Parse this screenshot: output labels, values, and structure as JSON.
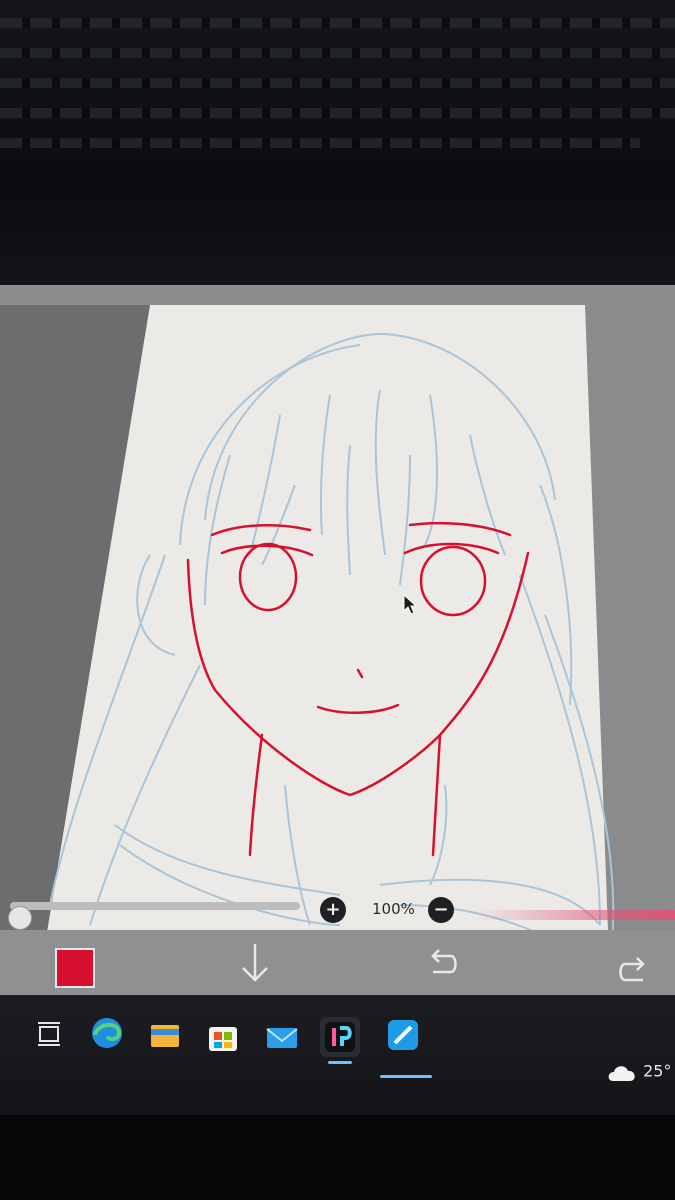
{
  "app": {
    "name": "ibisPaint"
  },
  "canvas": {
    "line_color": "#d8102f",
    "sketch_color": "#aac4d8",
    "paper_color": "#eceae6"
  },
  "zoom": {
    "level_text": "100%",
    "plus_label": "+",
    "minus_label": "−"
  },
  "toolbar": {
    "current_color": "#d8102f",
    "icons": [
      "color-swatch",
      "arrow-down-icon",
      "undo-icon",
      "redo-icon"
    ]
  },
  "taskbar": {
    "apps": [
      "task-view-icon",
      "edge-icon",
      "file-explorer-icon",
      "store-icon",
      "mail-icon",
      "ibispaint-icon",
      "pen-app-icon"
    ],
    "weather_temp": "25°"
  }
}
